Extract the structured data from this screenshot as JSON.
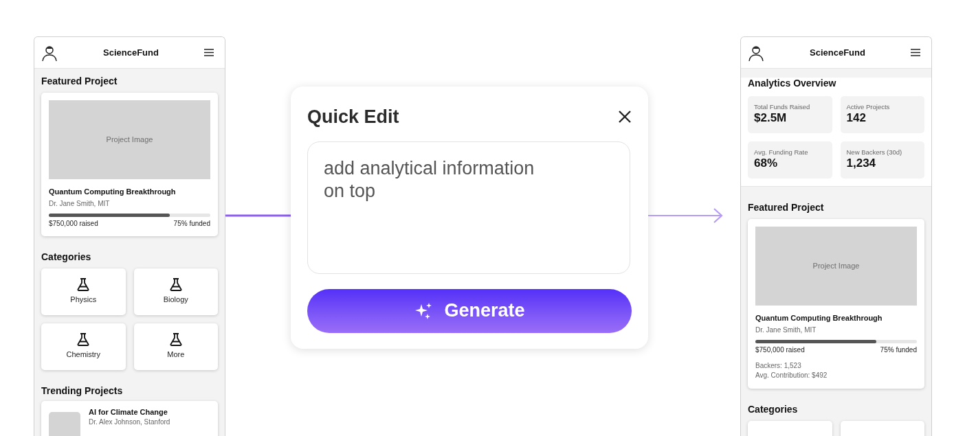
{
  "before": {
    "header": {
      "title": "ScienceFund"
    },
    "featured": {
      "title": "Featured Project",
      "project": {
        "image_label": "Project Image",
        "name": "Quantum Computing Breakthrough",
        "author": "Dr. Jane Smith, MIT",
        "level": 0.75,
        "raised": "$750,000 raised",
        "funded": "75% funded"
      }
    },
    "categories": {
      "title": "Categories",
      "items": [
        {
          "label": "Physics"
        },
        {
          "label": "Biology"
        },
        {
          "label": "Chemistry"
        },
        {
          "label": "More"
        }
      ]
    },
    "trending": {
      "title": "Trending Projects",
      "items": [
        {
          "name": "AI for Climate Change",
          "author": "Dr. Alex Johnson, Stanford"
        }
      ]
    }
  },
  "quick_edit": {
    "title": "Quick Edit",
    "prompt": "add analytical information\non top",
    "button": "Generate"
  },
  "after": {
    "header": {
      "title": "ScienceFund"
    },
    "analytics": {
      "title": "Analytics Overview",
      "stats": [
        {
          "label": "Total Funds Raised",
          "value": "$2.5M"
        },
        {
          "label": "Active Projects",
          "value": "142"
        },
        {
          "label": "Avg. Funding Rate",
          "value": "68%"
        },
        {
          "label": "New Backers (30d)",
          "value": "1,234"
        }
      ]
    },
    "featured": {
      "title": "Featured Project",
      "project": {
        "image_label": "Project Image",
        "name": "Quantum Computing Breakthrough",
        "author": "Dr. Jane Smith, MIT",
        "level": 0.75,
        "raised": "$750,000 raised",
        "funded": "75% funded",
        "details": [
          "Backers: 1,523",
          "Avg. Contribution: $492"
        ]
      }
    },
    "categories": {
      "title": "Categories"
    }
  }
}
